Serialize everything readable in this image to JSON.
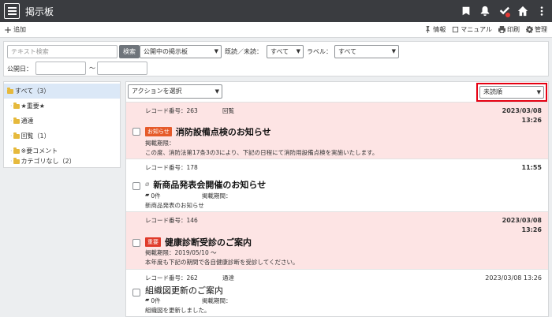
{
  "app": {
    "title": "掲示板"
  },
  "toolbar": {
    "add_label": "追加",
    "tools": [
      {
        "icon": "pin-icon",
        "label": "情報"
      },
      {
        "icon": "book-icon",
        "label": "マニュアル"
      },
      {
        "icon": "printer-icon",
        "label": "印刷"
      },
      {
        "icon": "gear-icon",
        "label": "管理"
      }
    ]
  },
  "filter": {
    "search_placeholder": "テキスト検索",
    "search_button": "検索",
    "board_select": "公開中の掲示板",
    "read_label": "既読／未読：",
    "read_select": "すべて",
    "label_label": "ラベル：",
    "label_select": "すべて",
    "date_label": "公開日：",
    "date_sep": "～"
  },
  "sidebar": {
    "items": [
      {
        "label": "すべて（3）",
        "active": true
      },
      {
        "label": "★重要★"
      },
      {
        "label": "通達"
      },
      {
        "label": "回覧（1）"
      },
      {
        "label": "※要コメント"
      },
      {
        "label": "カテゴリなし（2）"
      }
    ]
  },
  "main": {
    "action_select": "アクションを選択",
    "sort_select": "未読順",
    "records": [
      {
        "record_no": "レコード番号：263",
        "category": "回覧",
        "date": "2023/03/08",
        "time": "13:26",
        "tag": "お知らせ",
        "title": "消防設備点検のお知らせ",
        "period_label": "掲載期限：",
        "body": "この度、消防法第17条3の3により、下記の日程にて消防用設備点検を実施いたします。"
      },
      {
        "record_no": "レコード番号：178",
        "time": "11:55",
        "title": "新商品発表会開催のお知らせ",
        "comments": "0件",
        "period_label": "掲載期間：",
        "body": "新商品発表のお知らせ"
      },
      {
        "record_no": "レコード番号：146",
        "date": "2023/03/08",
        "time": "13:26",
        "tag": "重要",
        "title": "健康診断受診のご案内",
        "period": "掲載期限：2019/05/10 ～",
        "body": "本年度も下記の期間で各自健康診断を受診してください。"
      },
      {
        "record_no": "レコード番号：262",
        "category": "通達",
        "datetime": "2023/03/08 13:26",
        "title": "組織図更新のご案内",
        "comments": "0件",
        "period_label": "掲載期間：",
        "body": "組織図を更新しました。"
      }
    ]
  },
  "colors": {
    "titlebar": "#3a3c40",
    "pink_row": "#fde4e4",
    "highlight": "#e60012"
  }
}
